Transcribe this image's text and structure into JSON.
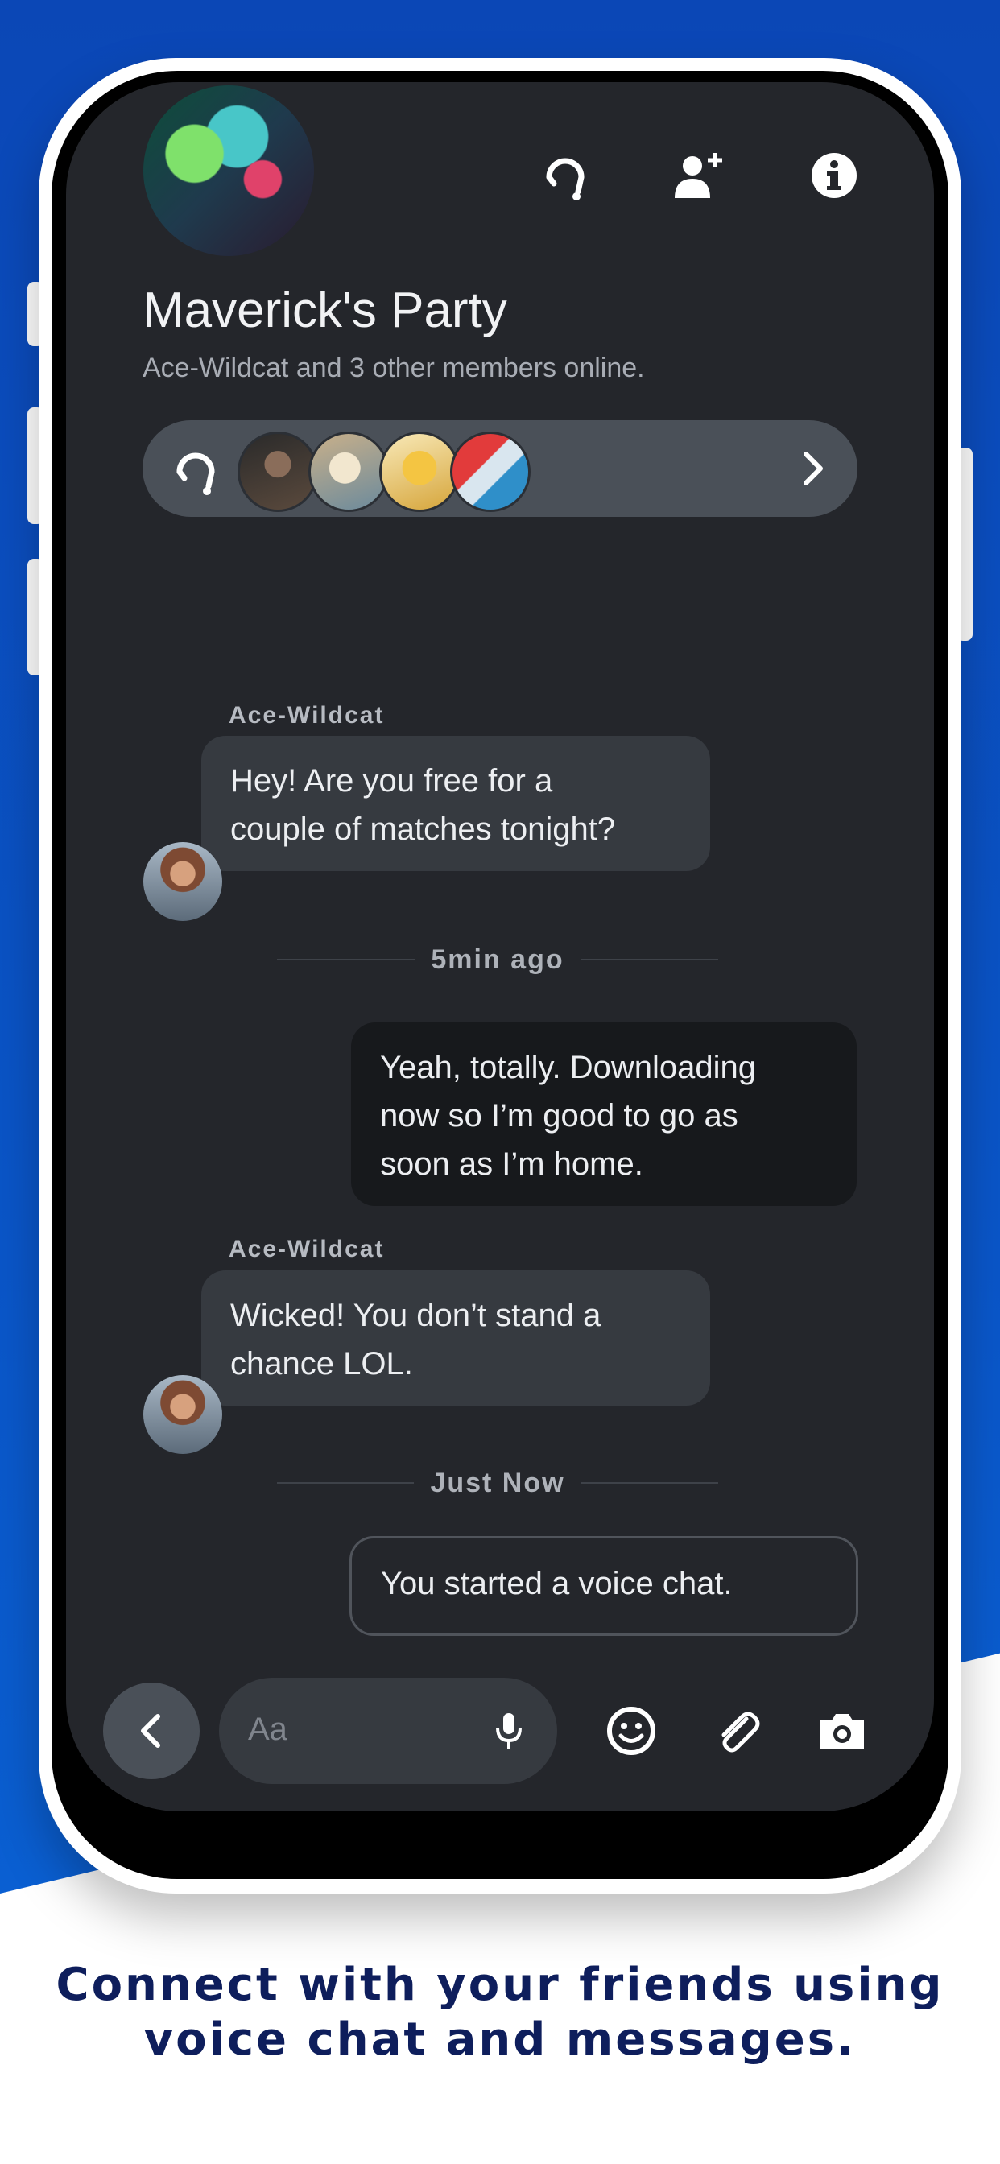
{
  "party": {
    "title": "Maverick's Party",
    "subtitle": "Ace-Wildcat and 3 other members online."
  },
  "messages": [
    {
      "sender": "Ace-Wildcat",
      "text_lines": [
        "Hey! Are you free for a",
        "couple of matches tonight?"
      ]
    },
    {
      "divider": "5min ago"
    },
    {
      "text_lines": [
        "Yeah, totally. Downloading",
        "now so I’m good to go as",
        "soon as I’m home."
      ]
    },
    {
      "sender": "Ace-Wildcat",
      "text_lines": [
        "Wicked! You don’t stand a",
        "chance LOL."
      ]
    },
    {
      "divider": "Just Now"
    },
    {
      "text_lines": [
        "You started a voice chat."
      ]
    }
  ],
  "input": {
    "placeholder": "Aa"
  },
  "icons": {
    "header": [
      "headset-icon",
      "add-friend-icon",
      "info-icon"
    ],
    "voice_bar": [
      "headset-icon",
      "chevron-right-icon"
    ],
    "input_bar": [
      "chevron-left-icon",
      "microphone-icon",
      "emoji-icon",
      "paperclip-icon",
      "camera-icon"
    ]
  },
  "caption": {
    "lines": [
      "Connect with your friends using",
      "voice chat and messages."
    ]
  },
  "colors": {
    "background_blue": "#0b47b6",
    "caption_text": "#0e1e5c",
    "screen_bg": "#24262b",
    "incoming_bubble": "#363a40",
    "outgoing_bubble": "#17191c"
  }
}
